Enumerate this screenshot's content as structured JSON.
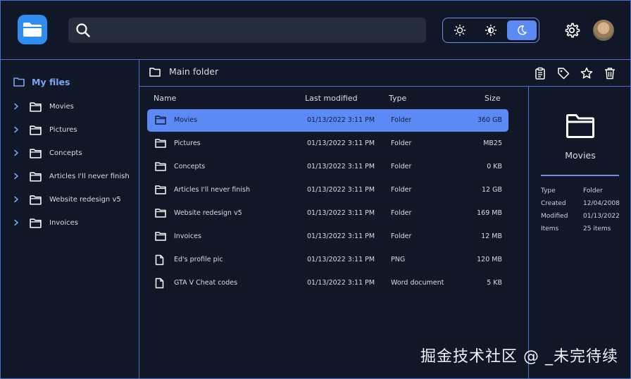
{
  "header": {
    "search": {
      "placeholder": "",
      "value": ""
    },
    "theme": {
      "options": [
        "light",
        "auto",
        "dark"
      ],
      "selected": "dark"
    },
    "accent": "#5b8af5",
    "border_color": "#4f72c9"
  },
  "sidebar": {
    "title": "My files",
    "items": [
      {
        "label": "Movies"
      },
      {
        "label": "Pictures"
      },
      {
        "label": "Concepts"
      },
      {
        "label": "Articles I'll never finish"
      },
      {
        "label": "Website redesign v5"
      },
      {
        "label": "Invoices"
      }
    ]
  },
  "breadcrumb": {
    "current": "Main folder"
  },
  "table": {
    "columns": {
      "name": "Name",
      "modified": "Last modified",
      "type": "Type",
      "size": "Size"
    },
    "rows": [
      {
        "icon": "folder-icon",
        "name": "Movies",
        "modified": "01/13/2022 3:11 PM",
        "type": "Folder",
        "size": "360 GB",
        "selected": true
      },
      {
        "icon": "folder-icon",
        "name": "Pictures",
        "modified": "01/13/2022 3:11 PM",
        "type": "Folder",
        "size": "MB25",
        "selected": false
      },
      {
        "icon": "folder-icon",
        "name": "Concepts",
        "modified": "01/13/2022 3:11 PM",
        "type": "Folder",
        "size": "0 KB",
        "selected": false
      },
      {
        "icon": "folder-icon",
        "name": "Articles I'll never finish",
        "modified": "01/13/2022 3:11 PM",
        "type": "Folder",
        "size": "12 GB",
        "selected": false
      },
      {
        "icon": "folder-icon",
        "name": "Website redesign v5",
        "modified": "01/13/2022 3:11 PM",
        "type": "Folder",
        "size": "169 MB",
        "selected": false
      },
      {
        "icon": "folder-icon",
        "name": "Invoices",
        "modified": "01/13/2022 3:11 PM",
        "type": "Folder",
        "size": "12 MB",
        "selected": false
      },
      {
        "icon": "file-icon",
        "name": "Ed's profile pic",
        "modified": "01/13/2022 3:11 PM",
        "type": "PNG",
        "size": "120 MB",
        "selected": false
      },
      {
        "icon": "file-icon",
        "name": "GTA V Cheat codes",
        "modified": "01/13/2022 3:11 PM",
        "type": "Word document",
        "size": "5 KB",
        "selected": false
      }
    ]
  },
  "details": {
    "name": "Movies",
    "properties": [
      {
        "key": "Type",
        "value": "Folder"
      },
      {
        "key": "Created",
        "value": "12/04/2008"
      },
      {
        "key": "Modified",
        "value": "01/13/2022"
      },
      {
        "key": "Items",
        "value": "25 items"
      }
    ]
  },
  "watermark": "掘金技术社区 @ _未完待续"
}
